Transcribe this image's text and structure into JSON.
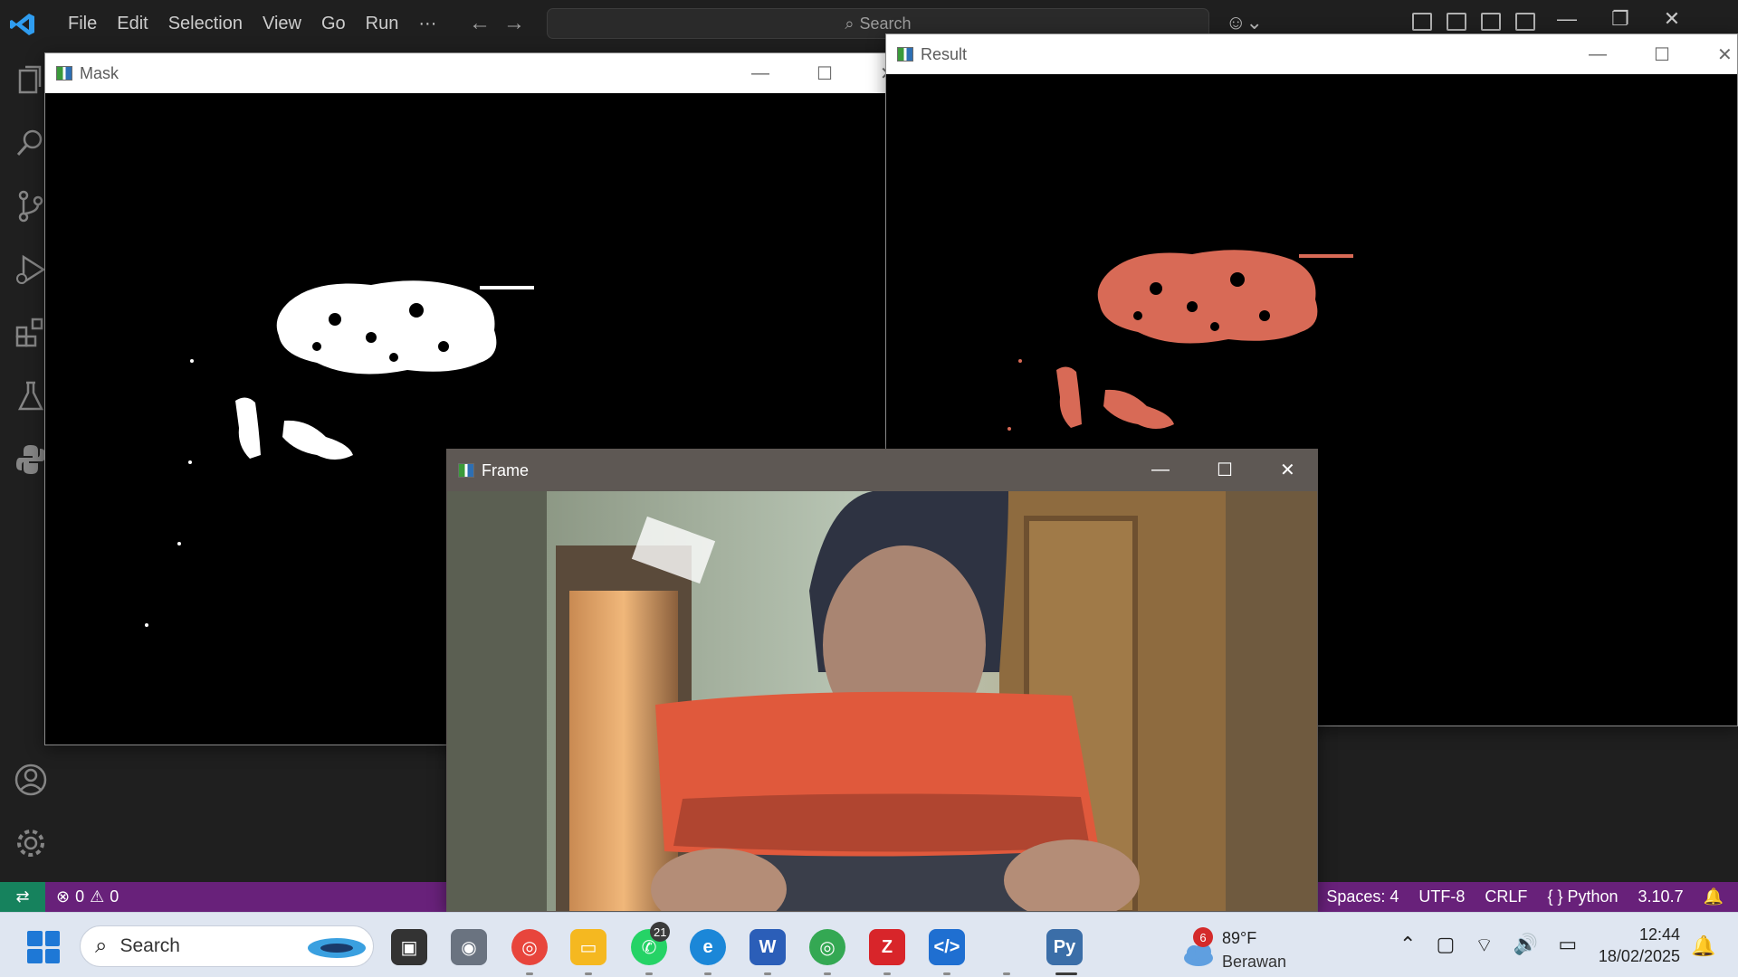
{
  "vscode": {
    "menu": [
      "File",
      "Edit",
      "Selection",
      "View",
      "Go",
      "Run",
      "···"
    ],
    "search_label": "Search",
    "status": {
      "errors": "0",
      "warnings": "0",
      "spaces": "Spaces: 4",
      "encoding": "UTF-8",
      "eol": "CRLF",
      "language": "Python",
      "version": "3.10.7"
    }
  },
  "windows": {
    "mask": {
      "title": "Mask"
    },
    "result": {
      "title": "Result"
    },
    "frame": {
      "title": "Frame"
    }
  },
  "taskbar": {
    "search_label": "Search",
    "whatsapp_badge": "21",
    "weather_badge": "6",
    "temperature": "89°F",
    "condition": "Berawan",
    "time": "12:44",
    "date": "18/02/2025"
  },
  "colors": {
    "status_bar": "#68217a",
    "remote": "#16825d",
    "mask_blob": "#ffffff",
    "result_blob": "#d86a56",
    "wallet": "#e0593c"
  }
}
